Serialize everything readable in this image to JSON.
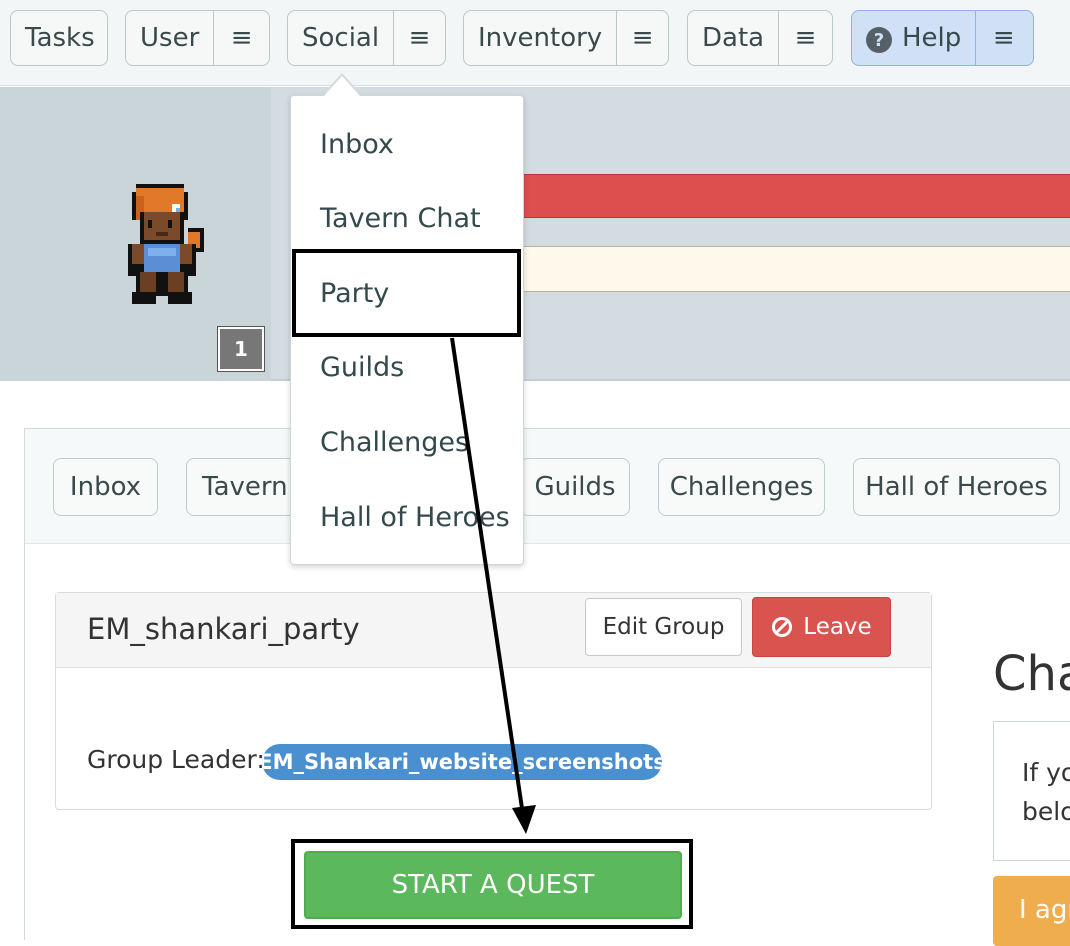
{
  "topnav": {
    "items": [
      {
        "label": "Tasks"
      },
      {
        "label": "User"
      },
      {
        "label": "Social"
      },
      {
        "label": "Inventory"
      },
      {
        "label": "Data"
      },
      {
        "label": "Help"
      }
    ],
    "menu_icon": "≡",
    "help_icon": "?"
  },
  "header": {
    "level": "1"
  },
  "social_dropdown": {
    "items": [
      {
        "label": "Inbox"
      },
      {
        "label": "Tavern Chat"
      },
      {
        "label": "Party"
      },
      {
        "label": "Guilds"
      },
      {
        "label": "Challenges"
      },
      {
        "label": "Hall of Heroes"
      }
    ],
    "highlighted": "Party"
  },
  "subnav": {
    "tabs": [
      {
        "label": "Inbox"
      },
      {
        "label": "Tavern"
      },
      {
        "label": "Guilds"
      },
      {
        "label": "Challenges"
      },
      {
        "label": "Hall of Heroes"
      }
    ]
  },
  "party": {
    "name": "EM_shankari_party",
    "edit_label": "Edit Group",
    "leave_label": "Leave",
    "leader_label": "Group Leader:",
    "leader_name": "EM_Shankari_website_screenshots",
    "start_quest_label": "START A QUEST"
  },
  "right_panel": {
    "heading": "Cha",
    "text_line1": "If yo",
    "text_line2": "belo",
    "button_label": "I agr"
  },
  "colors": {
    "hp_bar": "#dd4e4f",
    "start_quest": "#5cb85c",
    "leave": "#d9534f",
    "leader_pill": "#4a8fd0",
    "agree_button": "#f0ad4e"
  }
}
